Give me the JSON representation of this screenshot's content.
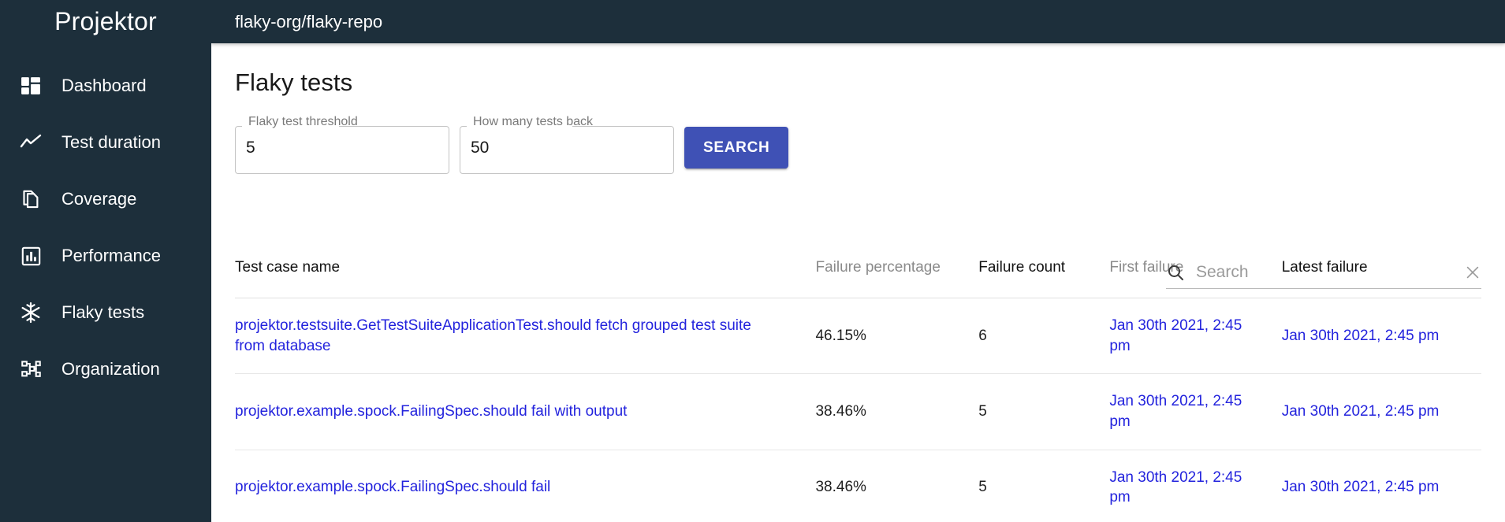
{
  "brand": "Projektor",
  "sidebar": {
    "items": [
      {
        "label": "Dashboard",
        "icon": "dashboard-icon"
      },
      {
        "label": "Test duration",
        "icon": "line-chart-icon"
      },
      {
        "label": "Coverage",
        "icon": "copy-documents-icon"
      },
      {
        "label": "Performance",
        "icon": "bar-chart-icon"
      },
      {
        "label": "Flaky tests",
        "icon": "snowflake-icon"
      },
      {
        "label": "Organization",
        "icon": "sitemap-icon"
      }
    ]
  },
  "topbar": {
    "title": "flaky-org/flaky-repo"
  },
  "page": {
    "title": "Flaky tests"
  },
  "filters": {
    "threshold": {
      "label": "Flaky test threshold",
      "value": "5"
    },
    "tests_back": {
      "label": "How many tests back",
      "value": "50"
    },
    "search_button": "SEARCH"
  },
  "table_search": {
    "placeholder": "Search",
    "value": ""
  },
  "table": {
    "columns": [
      {
        "key": "name",
        "label": "Test case name",
        "emphasis": "dark"
      },
      {
        "key": "pct",
        "label": "Failure percentage",
        "emphasis": "muted"
      },
      {
        "key": "count",
        "label": "Failure count",
        "emphasis": "dark"
      },
      {
        "key": "first",
        "label": "First failure",
        "emphasis": "muted"
      },
      {
        "key": "latest",
        "label": "Latest failure",
        "emphasis": "dark"
      }
    ],
    "rows": [
      {
        "name": "projektor.testsuite.GetTestSuiteApplicationTest.should fetch grouped test suite from database",
        "pct": "46.15%",
        "count": "6",
        "first": "Jan 30th 2021, 2:45 pm",
        "latest": "Jan 30th 2021, 2:45 pm"
      },
      {
        "name": "projektor.example.spock.FailingSpec.should fail with output",
        "pct": "38.46%",
        "count": "5",
        "first": "Jan 30th 2021, 2:45 pm",
        "latest": "Jan 30th 2021, 2:45 pm"
      },
      {
        "name": "projektor.example.spock.FailingSpec.should fail",
        "pct": "38.46%",
        "count": "5",
        "first": "Jan 30th 2021, 2:45 pm",
        "latest": "Jan 30th 2021, 2:45 pm"
      }
    ]
  },
  "colors": {
    "sidebar_bg": "#1d2f3b",
    "accent": "#3f51b5",
    "link": "#2323dd",
    "muted_text": "#8a8a8a"
  }
}
